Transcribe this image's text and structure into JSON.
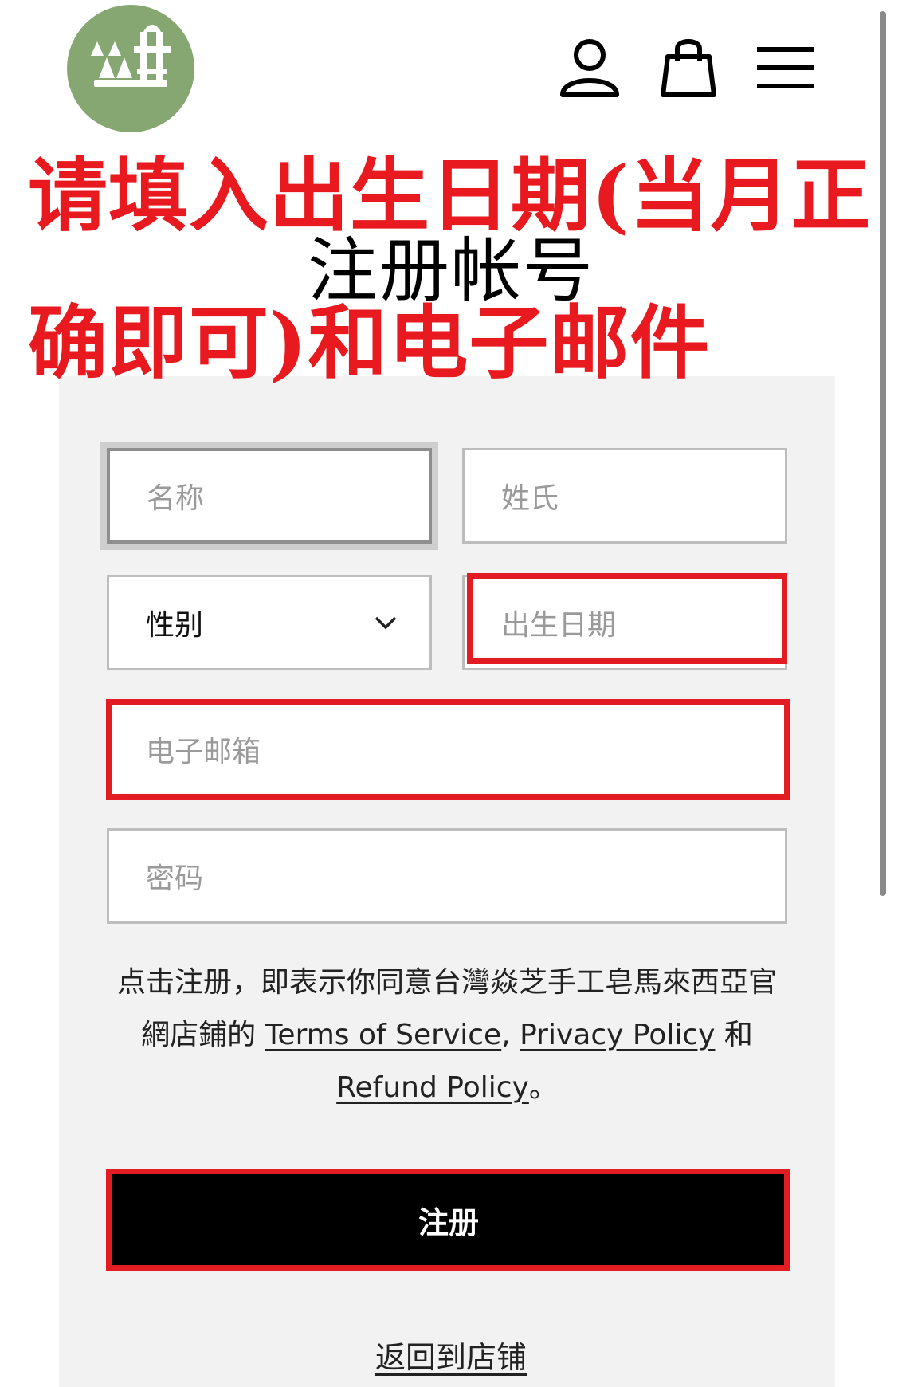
{
  "header": {
    "logo_name": "store-logo",
    "icons": [
      "account-icon",
      "shopping-bag-icon",
      "menu-icon"
    ]
  },
  "annotation": {
    "line1": "请填入出生日期(当月正",
    "line2": "确即可)和电子邮件",
    "color": "#e8191f"
  },
  "page": {
    "title": "注册帐号"
  },
  "form": {
    "first_name_placeholder": "名称",
    "last_name_placeholder": "姓氏",
    "gender_value": "性别",
    "birthday_placeholder": "出生日期",
    "email_placeholder": "电子邮箱",
    "password_placeholder": "密码",
    "terms_prefix": "点击注册，即表示你同意台灣焱芝手工皂馬來西亞官網店鋪的",
    "terms_link": "Terms of Service",
    "terms_sep": ",",
    "privacy_link": "Privacy Policy",
    "terms_and": "和",
    "refund_link": "Refund Policy",
    "terms_end": "。",
    "submit_label": "注册",
    "back_label": "返回到店铺"
  },
  "colors": {
    "highlight": "#e31c24",
    "logo_bg": "#86a672",
    "panel_bg": "#f2f2f2"
  }
}
